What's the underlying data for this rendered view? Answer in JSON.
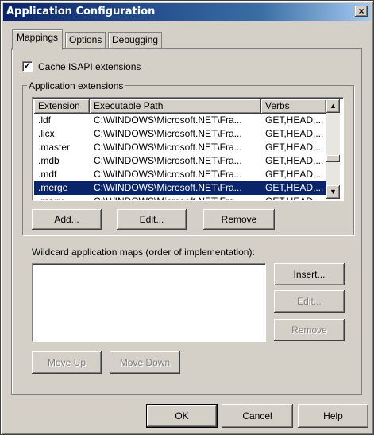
{
  "window": {
    "title": "Application Configuration",
    "close_glyph": "×"
  },
  "tabs": [
    {
      "label": "Mappings",
      "active": true
    },
    {
      "label": "Options",
      "active": false
    },
    {
      "label": "Debugging",
      "active": false
    }
  ],
  "cache_isapi": {
    "label": "Cache ISAPI extensions",
    "checked": true,
    "check_glyph": "✓"
  },
  "app_extensions": {
    "group_label": "Application extensions",
    "columns": [
      "Extension",
      "Executable Path",
      "Verbs"
    ],
    "rows": [
      {
        "ext": ".ldf",
        "path": "C:\\WINDOWS\\Microsoft.NET\\Fra...",
        "verbs": "GET,HEAD,..."
      },
      {
        "ext": ".licx",
        "path": "C:\\WINDOWS\\Microsoft.NET\\Fra...",
        "verbs": "GET,HEAD,..."
      },
      {
        "ext": ".master",
        "path": "C:\\WINDOWS\\Microsoft.NET\\Fra...",
        "verbs": "GET,HEAD,..."
      },
      {
        "ext": ".mdb",
        "path": "C:\\WINDOWS\\Microsoft.NET\\Fra...",
        "verbs": "GET,HEAD,..."
      },
      {
        "ext": ".mdf",
        "path": "C:\\WINDOWS\\Microsoft.NET\\Fra...",
        "verbs": "GET,HEAD,..."
      },
      {
        "ext": ".merge",
        "path": "C:\\WINDOWS\\Microsoft.NET\\Fra...",
        "verbs": "GET,HEAD,...",
        "selected": true
      },
      {
        "ext": ".msgx",
        "path": "C:\\WINDOWS\\Microsoft.NET\\Fra...",
        "verbs": "GET,HEAD,..."
      }
    ],
    "scroll_up_glyph": "▲",
    "scroll_down_glyph": "▼",
    "add_label": "Add...",
    "edit_label": "Edit...",
    "remove_label": "Remove"
  },
  "wildcard": {
    "label": "Wildcard application maps (order of implementation):",
    "insert_label": "Insert...",
    "edit_label": "Edit...",
    "remove_label": "Remove",
    "move_up_label": "Move Up",
    "move_down_label": "Move Down"
  },
  "footer": {
    "ok_label": "OK",
    "cancel_label": "Cancel",
    "help_label": "Help"
  },
  "colors": {
    "face": "#d4d0c8",
    "title_start": "#0a246a",
    "title_end": "#a6caf0",
    "selection": "#0a246a"
  }
}
